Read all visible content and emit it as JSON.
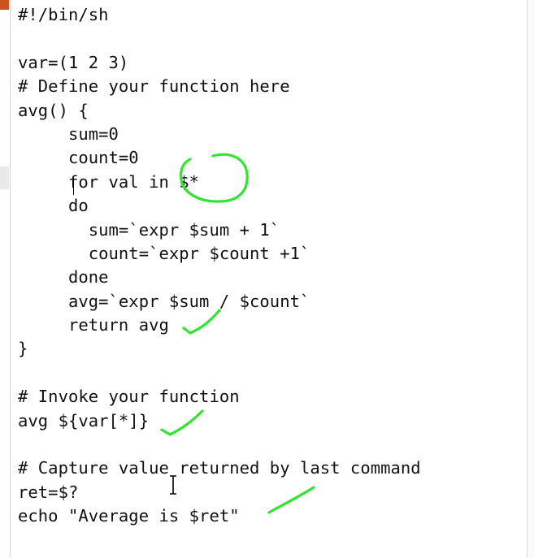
{
  "editor": {
    "lines": [
      "#!/bin/sh",
      "",
      "var=(1 2 3)",
      "# Define your function here",
      "avg() {",
      "     sum=0",
      "     count=0",
      "     for val in $*",
      "     do",
      "       sum=`expr $sum + 1`",
      "       count=`expr $count +1`",
      "     done",
      "     avg=`expr $sum / $count`",
      "     return avg",
      "}",
      "",
      "# Invoke your function",
      "avg ${var[*]}",
      "",
      "# Capture value returned by last command",
      "ret=$?",
      "echo \"Average is $ret\""
    ]
  },
  "colors": {
    "annotation": "#2ee62e",
    "text": "#111111",
    "accent_strip": "#c9541f"
  },
  "icons": {
    "cursor": "i-beam-cursor"
  }
}
